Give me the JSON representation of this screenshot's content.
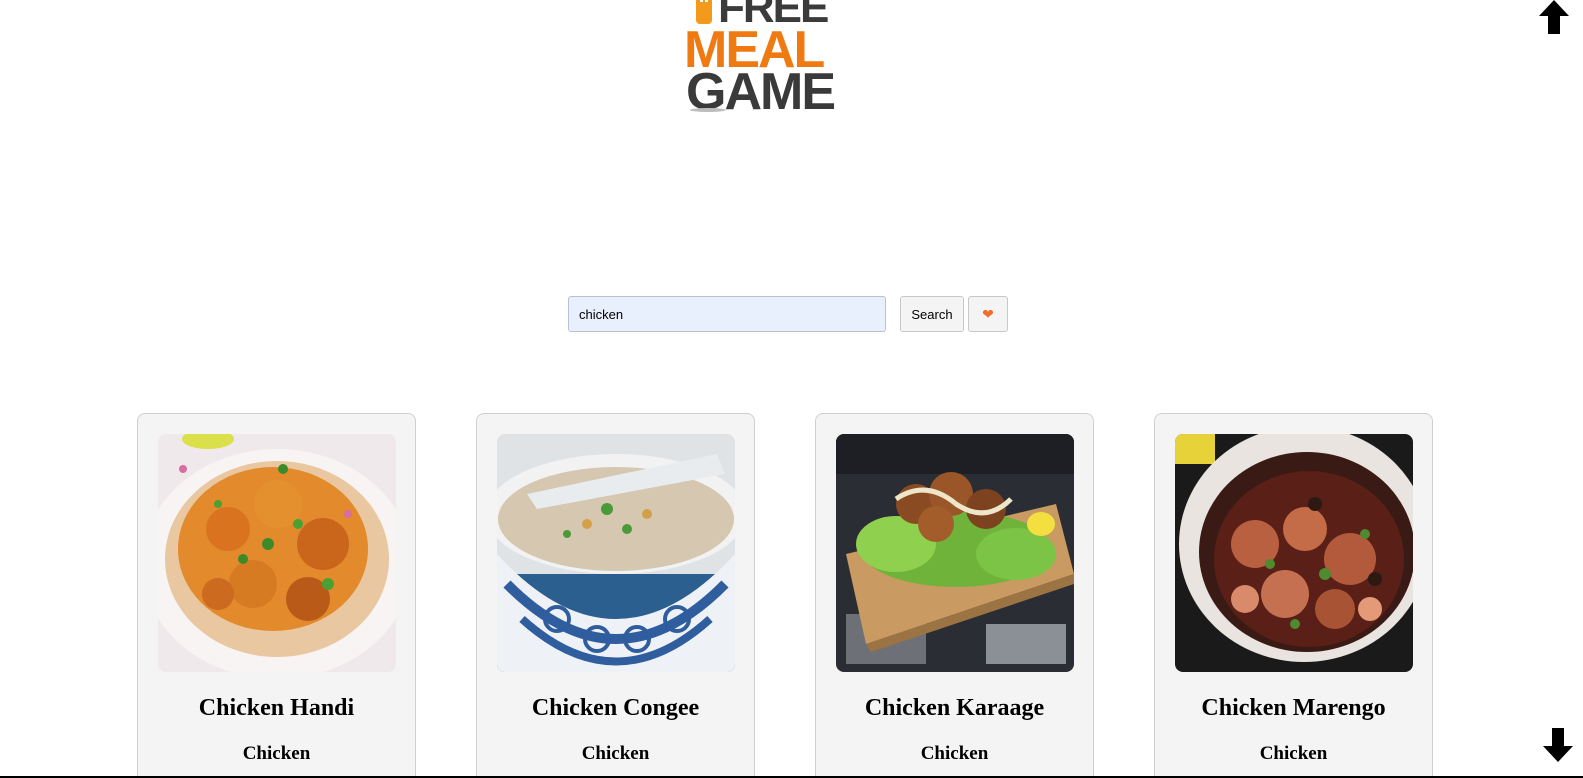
{
  "logo": {
    "line1": "FREE",
    "line2": "MEAL",
    "line3": "GAME",
    "colors": {
      "orange": "#f07a12",
      "dark": "#3a3a3a"
    }
  },
  "scroll": {
    "up_icon": "arrow-up-icon",
    "down_icon": "arrow-down-icon"
  },
  "search": {
    "value": "chicken",
    "button_label": "Search",
    "favorites_icon": "heart-icon",
    "heart_glyph": "❤"
  },
  "recipes": [
    {
      "title": "Chicken Handi",
      "category": "Chicken"
    },
    {
      "title": "Chicken Congee",
      "category": "Chicken"
    },
    {
      "title": "Chicken Karaage",
      "category": "Chicken"
    },
    {
      "title": "Chicken Marengo",
      "category": "Chicken"
    }
  ]
}
